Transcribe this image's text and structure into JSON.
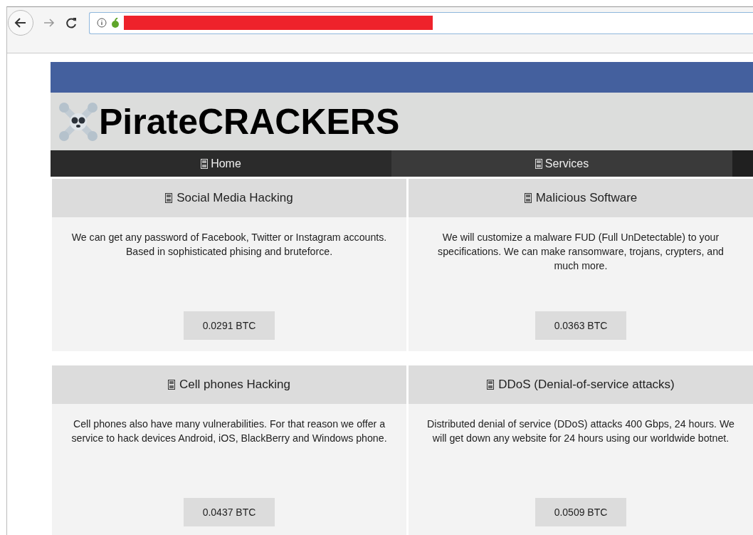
{
  "site": {
    "title": "PirateCRACKERS"
  },
  "nav": [
    {
      "label": "Home",
      "selected": false
    },
    {
      "label": "Services",
      "selected": true
    }
  ],
  "services": [
    {
      "title": "Social Media Hacking",
      "text": "We can get any password of Facebook, Twitter or Instagram accounts. Based in sophisticated phising and bruteforce.",
      "price": "0.0291 BTC"
    },
    {
      "title": "Malicious Software",
      "text": "We will customize a malware FUD (Full UnDetectable) to your specifications. We can make ransomware, trojans, crypters, and much more.",
      "price": "0.0363 BTC"
    },
    {
      "title": "Cell phones Hacking",
      "text": "Cell phones also have many vulnerabilities. For that reason we offer a service to hack devices Android, iOS, BlackBerry and Windows phone.",
      "price": "0.0437 BTC"
    },
    {
      "title": "DDoS (Denial-of-service attacks)",
      "text": "Distributed denial of service (DDoS) attacks 400 Gbps, 24 hours. We will get down any website for 24 hours using our worldwide botnet.",
      "price": "0.0509 BTC"
    }
  ]
}
